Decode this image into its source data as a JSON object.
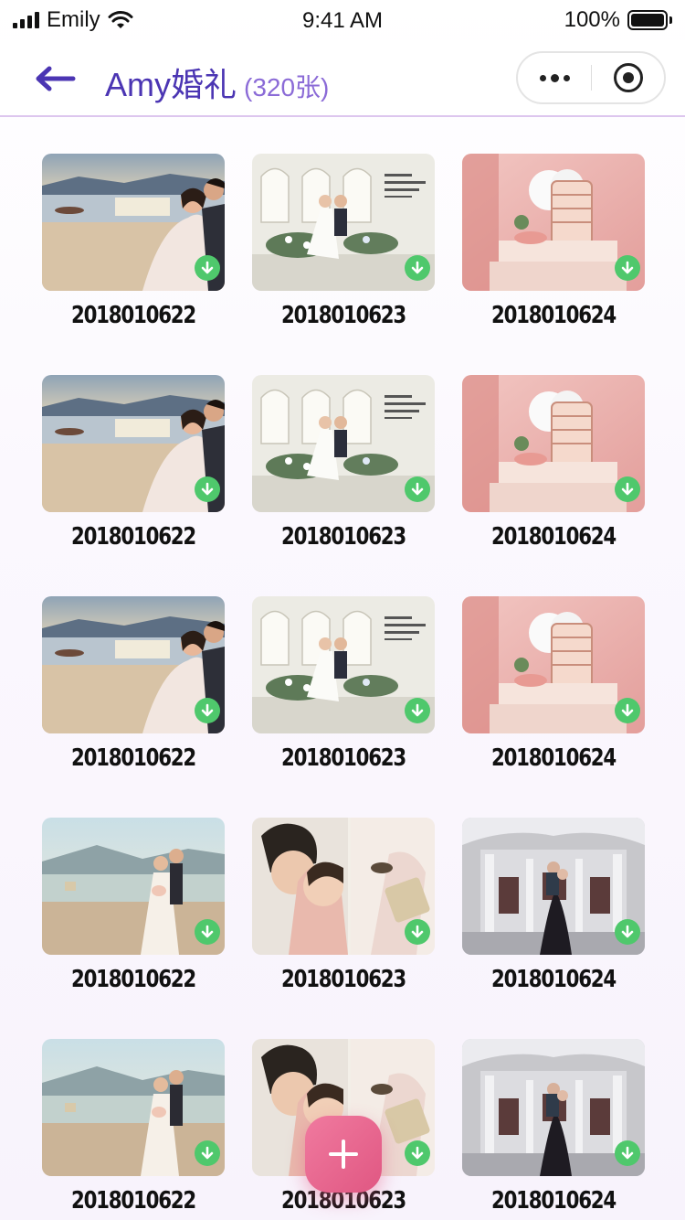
{
  "status_bar": {
    "carrier": "Emily",
    "time": "9:41 AM",
    "battery": "100%"
  },
  "header": {
    "title": "Amy婚礼",
    "count": "(320张)",
    "back_icon": "arrow-left-icon",
    "more_icon": "more-dots-icon",
    "close_icon": "target-circle-icon"
  },
  "colors": {
    "accent": "#4b35b3",
    "count_text": "#8b6bd7",
    "download_badge": "#4fc86c",
    "fab": "#e9688f",
    "header_border": "#ddc6ee"
  },
  "photos": [
    {
      "caption": "2018010622",
      "scene": "beach-sunset"
    },
    {
      "caption": "2018010623",
      "scene": "white-studio"
    },
    {
      "caption": "2018010624",
      "scene": "pink-set"
    },
    {
      "caption": "2018010622",
      "scene": "beach-sunset"
    },
    {
      "caption": "2018010623",
      "scene": "white-studio"
    },
    {
      "caption": "2018010624",
      "scene": "pink-set"
    },
    {
      "caption": "2018010622",
      "scene": "beach-sunset"
    },
    {
      "caption": "2018010623",
      "scene": "white-studio"
    },
    {
      "caption": "2018010624",
      "scene": "pink-set"
    },
    {
      "caption": "2018010622",
      "scene": "beach-standing"
    },
    {
      "caption": "2018010623",
      "scene": "couple-closeup"
    },
    {
      "caption": "2018010624",
      "scene": "gray-castle"
    },
    {
      "caption": "2018010622",
      "scene": "beach-standing"
    },
    {
      "caption": "2018010623",
      "scene": "couple-closeup"
    },
    {
      "caption": "2018010624",
      "scene": "gray-castle"
    }
  ],
  "fab": {
    "icon": "plus-icon"
  }
}
